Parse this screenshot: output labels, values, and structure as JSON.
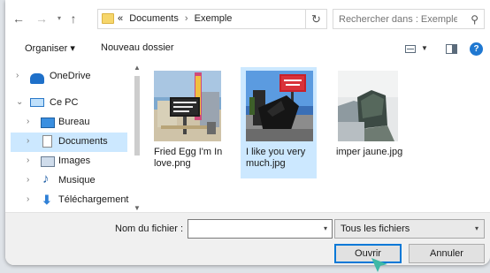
{
  "address_bar": {
    "back_icon": "arrow-left-icon",
    "forward_icon": "arrow-right-icon",
    "up_icon": "arrow-up-icon",
    "prefix": "«",
    "crumbs": [
      "Documents",
      "Exemple"
    ],
    "separator": "›",
    "refresh_icon": "refresh-icon",
    "search_placeholder": "Rechercher dans : Exemple"
  },
  "toolbar": {
    "organize_label": "Organiser ▾",
    "new_folder_label": "Nouveau dossier"
  },
  "sidebar": {
    "items": [
      {
        "label": "OneDrive",
        "icon": "onedrive-cloud-icon",
        "expanded": false
      },
      {
        "label": "Ce PC",
        "icon": "computer-icon",
        "expanded": true
      },
      {
        "label": "Bureau",
        "icon": "desktop-folder-icon",
        "expanded": false
      },
      {
        "label": "Documents",
        "icon": "documents-folder-icon",
        "expanded": false,
        "selected": true
      },
      {
        "label": "Images",
        "icon": "pictures-folder-icon",
        "expanded": false
      },
      {
        "label": "Musique",
        "icon": "music-folder-icon",
        "expanded": false
      },
      {
        "label": "Téléchargement",
        "icon": "downloads-folder-icon",
        "expanded": false
      }
    ]
  },
  "files": [
    {
      "name": "Fried Egg I'm In love.png",
      "selected": false
    },
    {
      "name": "I like you very much.jpg",
      "selected": true
    },
    {
      "name": "imper jaune.jpg",
      "selected": false
    }
  ],
  "footer": {
    "filename_label": "Nom du fichier :",
    "filename_value": "",
    "filetype_value": "Tous les fichiers",
    "open_label": "Ouvrir",
    "cancel_label": "Annuler"
  },
  "colors": {
    "selection": "#cce8ff",
    "accent": "#0078d7",
    "cursor": "#3fb8a6"
  }
}
